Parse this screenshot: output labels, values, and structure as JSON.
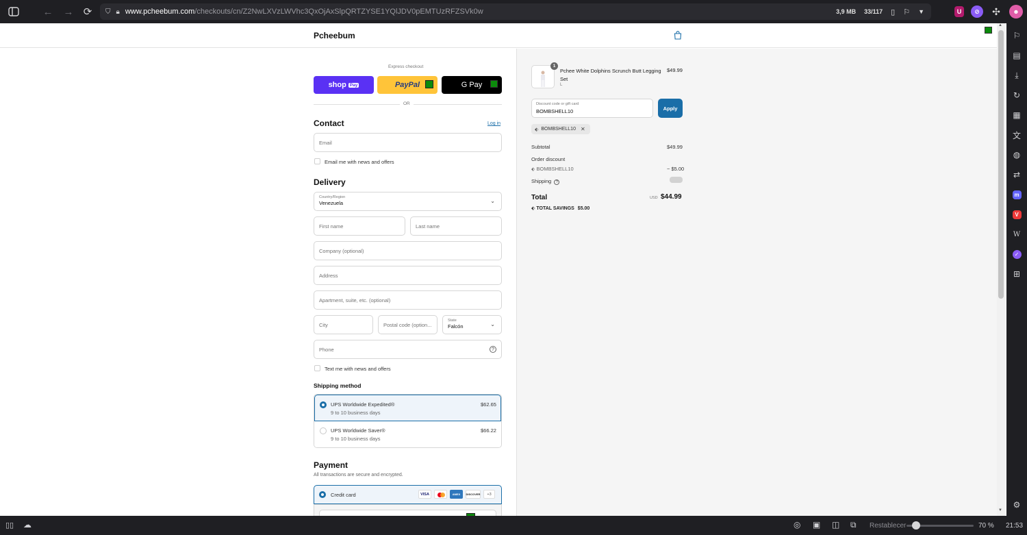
{
  "browser": {
    "url_domain": "www.pcheebum.com",
    "url_path": "/checkouts/cn/Z2NwLXVzLWVhc3QxOjAxSlpQRTZYSE1YQlJDV0pEMTUzRFZSVk0w",
    "memory": "3,9 MB",
    "tab_count": "33/117",
    "zoom_reset": "Restablecer",
    "zoom_level": "70 %",
    "clock": "21:53"
  },
  "store": {
    "name": "Pcheebum"
  },
  "express": {
    "title": "Express checkout",
    "shop_pay": "shop",
    "shop_pay_badge": "Pay",
    "paypal": "PayPal",
    "gpay": "G Pay",
    "or_label": "OR"
  },
  "contact": {
    "heading": "Contact",
    "login_link": "Log in",
    "email_placeholder": "Email",
    "news_checkbox": "Email me with news and offers"
  },
  "delivery": {
    "heading": "Delivery",
    "country_label": "Country/Region",
    "country_value": "Venezuela",
    "first_name": "First name",
    "last_name": "Last name",
    "company": "Company (optional)",
    "address": "Address",
    "apartment": "Apartment, suite, etc. (optional)",
    "city": "City",
    "postal": "Postal code (option...",
    "state_label": "State",
    "state_value": "Falcón",
    "phone": "Phone",
    "text_checkbox": "Text me with news and offers"
  },
  "shipping": {
    "heading": "Shipping method",
    "options": [
      {
        "name": "UPS Worldwide Expedited®",
        "eta": "9 to 10 business days",
        "price": "$62.65"
      },
      {
        "name": "UPS Worldwide Saver®",
        "eta": "9 to 10 business days",
        "price": "$66.22"
      }
    ]
  },
  "payment": {
    "heading": "Payment",
    "subtitle": "All transactions are secure and encrypted.",
    "method": "Credit card",
    "cards": [
      "VISA",
      "MC",
      "AMEX",
      "DISCOVER"
    ],
    "more_cards": "+3"
  },
  "summary": {
    "item_name": "Pchee White Dolphins Scrunch Butt Legging Set",
    "item_variant": "L",
    "item_qty": "1",
    "item_price": "$49.99",
    "discount_label": "Discount code or gift card",
    "discount_value": "BOMBSHELL10",
    "apply_button": "Apply",
    "applied_code": "BOMBSHELL10",
    "subtotal_label": "Subtotal",
    "subtotal_value": "$49.99",
    "order_discount_label": "Order discount",
    "order_discount_code": "BOMBSHELL10",
    "order_discount_value": "− $5.00",
    "shipping_label": "Shipping",
    "total_label": "Total",
    "currency": "USD",
    "total_value": "$44.99",
    "savings_label": "TOTAL SAVINGS",
    "savings_value": "$5.00"
  },
  "colors": {
    "accent": "#1a6ea8",
    "shop_pay": "#5a31f4",
    "paypal": "#ffc439"
  }
}
